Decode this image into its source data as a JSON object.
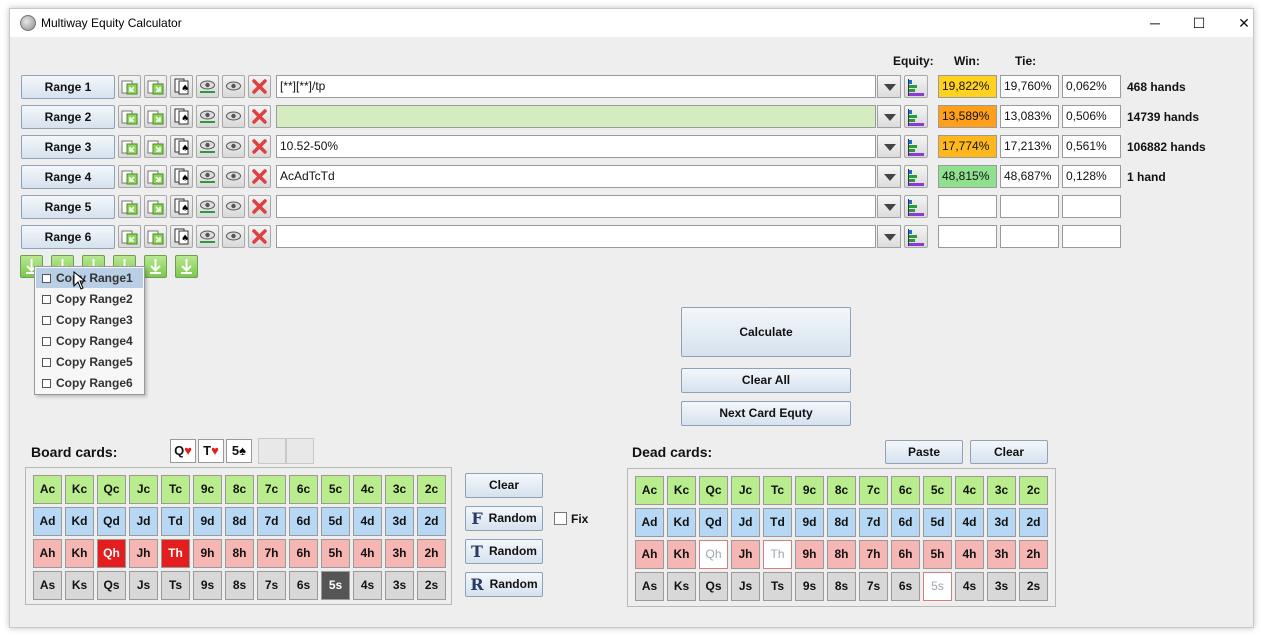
{
  "window": {
    "title": "Multiway Equity Calculator",
    "minimize": "─",
    "maximize": "☐",
    "close": "✕"
  },
  "headers": {
    "equity": "Equity:",
    "win": "Win:",
    "tie": "Tie:"
  },
  "ranges": [
    {
      "label": "Range 1",
      "value": "[**][**]/tp",
      "win": "19,822%",
      "tie": "19,760%",
      "share": "0,062%",
      "hands": "468 hands",
      "win_color": "#ffd21f"
    },
    {
      "label": "Range 2",
      "value": "",
      "win": "13,589%",
      "tie": "13,083%",
      "share": "0,506%",
      "hands": "14739 hands",
      "win_color": "#ff9f1a"
    },
    {
      "label": "Range 3",
      "value": "10.52-50%",
      "win": "17,774%",
      "tie": "17,213%",
      "share": "0,561%",
      "hands": "106882 hands",
      "win_color": "#ffb81c"
    },
    {
      "label": "Range 4",
      "value": "AcAdTcTd",
      "win": "48,815%",
      "tie": "48,687%",
      "share": "0,128%",
      "hands": "1 hand",
      "win_color": "#8fe08f"
    },
    {
      "label": "Range 5",
      "value": "",
      "win": "",
      "tie": "",
      "share": "",
      "hands": "",
      "win_color": "#ffffff"
    },
    {
      "label": "Range 6",
      "value": "",
      "win": "",
      "tie": "",
      "share": "",
      "hands": "",
      "win_color": "#ffffff"
    }
  ],
  "copy_menu": [
    "Copy Range1",
    "Copy Range2",
    "Copy Range3",
    "Copy Range4",
    "Copy Range5",
    "Copy Range6"
  ],
  "actions": {
    "calculate": "Calculate",
    "clear_all": "Clear All",
    "next_card": "Next Card Equty"
  },
  "board": {
    "title": "Board cards:",
    "selected": [
      {
        "rank": "Q",
        "suit": "♥"
      },
      {
        "rank": "T",
        "suit": "♥"
      },
      {
        "rank": "5",
        "suit": "♠"
      }
    ],
    "clear": "Clear",
    "random_f": "Random",
    "random_t": "Random",
    "random_r": "Random",
    "icon_f": "F",
    "icon_t": "T",
    "icon_r": "R",
    "fix": "Fix",
    "picked": [
      "Qh",
      "Th",
      "5s"
    ]
  },
  "dead": {
    "title": "Dead cards:",
    "paste": "Paste",
    "clear": "Clear",
    "used": [
      "Qh",
      "Th",
      "5s"
    ]
  },
  "ranks": [
    "A",
    "K",
    "Q",
    "J",
    "T",
    "9",
    "8",
    "7",
    "6",
    "5",
    "4",
    "3",
    "2"
  ],
  "suits": [
    "c",
    "d",
    "h",
    "s"
  ],
  "colors": {
    "range2_bg": "#d4ecc0"
  }
}
